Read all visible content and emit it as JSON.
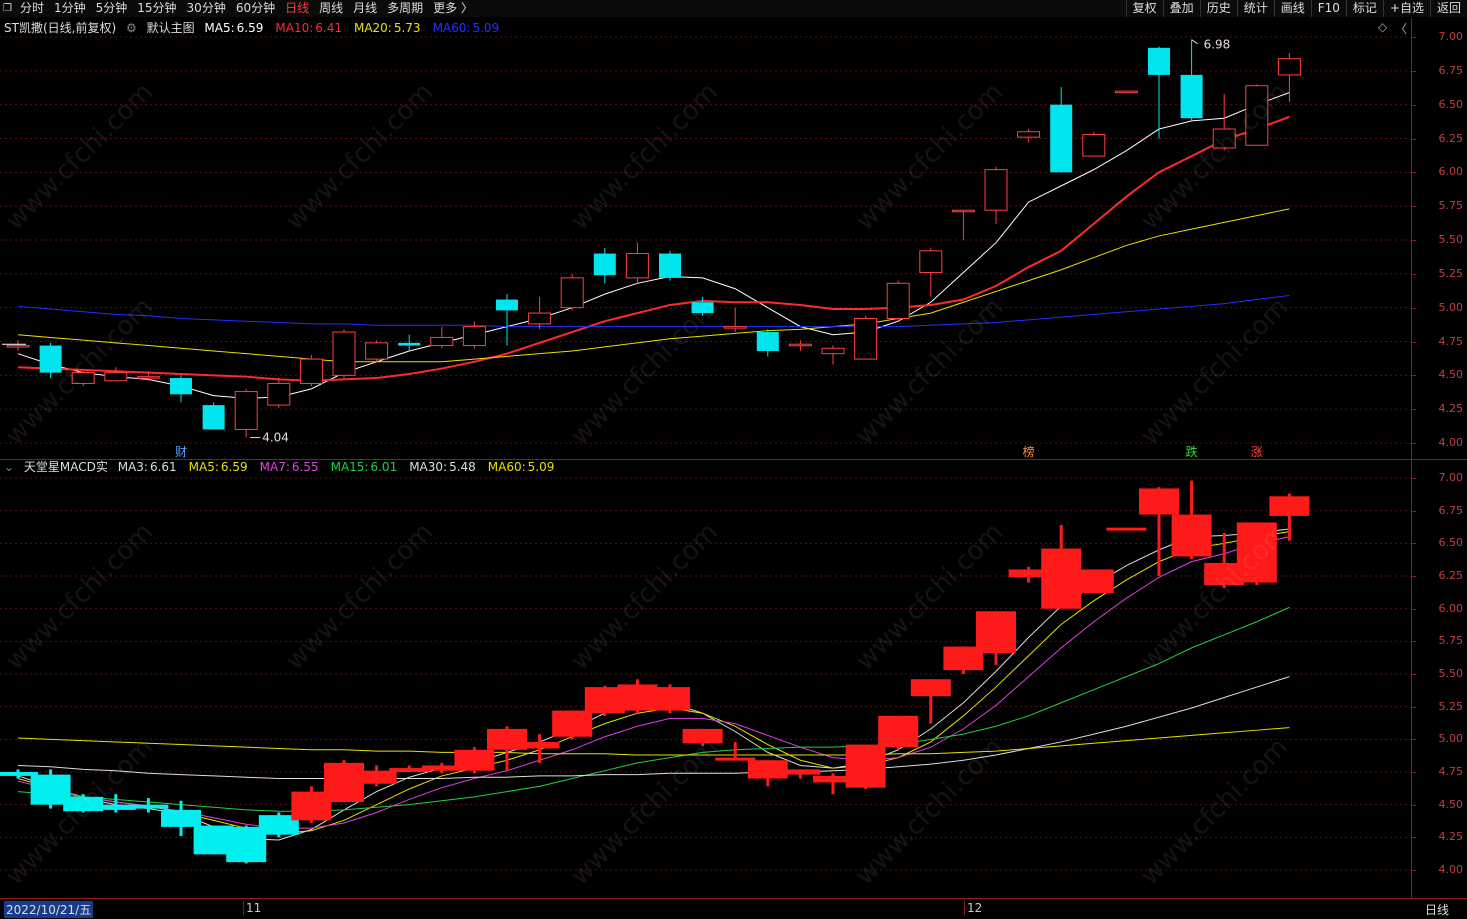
{
  "toolbar": {
    "corner_icon": "restore-icon",
    "periods": [
      "分时",
      "1分钟",
      "5分钟",
      "15分钟",
      "30分钟",
      "60分钟",
      "日线",
      "周线",
      "月线",
      "多周期",
      "更多 〉"
    ],
    "active_index": 6,
    "right_buttons": [
      "复权",
      "叠加",
      "历史",
      "统计",
      "画线",
      "F10",
      "标记",
      "+自选",
      "返回"
    ]
  },
  "main_panel": {
    "title": "ST凯撒(日线,前复权)",
    "indicator_name": "默认主图",
    "ma": [
      {
        "label": "MA5:",
        "value": "6.59",
        "color": "#ffffff"
      },
      {
        "label": "MA10:",
        "value": "6.41",
        "color": "#ff2a2a"
      },
      {
        "label": "MA20:",
        "value": "5.73",
        "color": "#e8e000"
      },
      {
        "label": "MA60:",
        "value": "5.09",
        "color": "#2030ff"
      }
    ],
    "y_ticks": [
      "7.00",
      "6.75",
      "6.50",
      "6.25",
      "6.00",
      "5.75",
      "5.50",
      "5.25",
      "5.00",
      "4.75",
      "4.50",
      "4.25",
      "4.00"
    ],
    "high_label": "6.98",
    "low_label": "4.04",
    "markers": [
      {
        "text": "财",
        "color": "#5aa0ff"
      },
      {
        "text": "榜",
        "color": "#ff8c3a"
      },
      {
        "text": "跌",
        "color": "#33dd33"
      },
      {
        "text": "涨",
        "color": "#ff4a4a"
      }
    ]
  },
  "sub_panel": {
    "title": "天堂星MACD实",
    "ma": [
      {
        "label": "MA3:",
        "value": "6.61",
        "color": "#dddddd"
      },
      {
        "label": "MA5:",
        "value": "6.59",
        "color": "#e8e000"
      },
      {
        "label": "MA7:",
        "value": "6.55",
        "color": "#e040e0"
      },
      {
        "label": "MA15:",
        "value": "6.01",
        "color": "#20d040"
      },
      {
        "label": "MA30:",
        "value": "5.48",
        "color": "#dddddd"
      },
      {
        "label": "MA60:",
        "value": "5.09",
        "color": "#e8e000"
      }
    ],
    "y_ticks": [
      "7.00",
      "6.75",
      "6.50",
      "6.25",
      "6.00",
      "5.75",
      "5.50",
      "5.25",
      "5.00",
      "4.75",
      "4.50",
      "4.25",
      "4.00"
    ]
  },
  "bottom_bar": {
    "date": "2022/10/21/五",
    "month_11": "11",
    "month_12": "12",
    "period": "日线"
  },
  "watermark": "www.cfchi.com",
  "chart_data": {
    "type": "candlestick",
    "ylim": [
      3.95,
      7.05
    ],
    "candles": [
      {
        "o": 4.72,
        "c": 4.72,
        "h": 4.76,
        "l": 4.68
      },
      {
        "o": 4.72,
        "c": 4.52,
        "h": 4.74,
        "l": 4.48
      },
      {
        "o": 4.44,
        "c": 4.52,
        "h": 4.54,
        "l": 4.42
      },
      {
        "o": 4.46,
        "c": 4.52,
        "h": 4.56,
        "l": 4.46
      },
      {
        "o": 4.49,
        "c": 4.49,
        "h": 4.53,
        "l": 4.46
      },
      {
        "o": 4.48,
        "c": 4.36,
        "h": 4.5,
        "l": 4.3
      },
      {
        "o": 4.28,
        "c": 4.1,
        "h": 4.3,
        "l": 4.1
      },
      {
        "o": 4.1,
        "c": 4.38,
        "h": 4.4,
        "l": 4.04
      },
      {
        "o": 4.28,
        "c": 4.44,
        "h": 4.48,
        "l": 4.26
      },
      {
        "o": 4.44,
        "c": 4.62,
        "h": 4.65,
        "l": 4.42
      },
      {
        "o": 4.5,
        "c": 4.82,
        "h": 4.84,
        "l": 4.48
      },
      {
        "o": 4.62,
        "c": 4.74,
        "h": 4.76,
        "l": 4.6
      },
      {
        "o": 4.74,
        "c": 4.72,
        "h": 4.8,
        "l": 4.68
      },
      {
        "o": 4.72,
        "c": 4.78,
        "h": 4.86,
        "l": 4.7
      },
      {
        "o": 4.72,
        "c": 4.86,
        "h": 4.9,
        "l": 4.7
      },
      {
        "o": 5.06,
        "c": 4.98,
        "h": 5.1,
        "l": 4.72
      },
      {
        "o": 4.88,
        "c": 4.96,
        "h": 5.08,
        "l": 4.84
      },
      {
        "o": 5.0,
        "c": 5.22,
        "h": 5.25,
        "l": 4.98
      },
      {
        "o": 5.4,
        "c": 5.24,
        "h": 5.44,
        "l": 5.18
      },
      {
        "o": 5.22,
        "c": 5.4,
        "h": 5.48,
        "l": 5.18
      },
      {
        "o": 5.4,
        "c": 5.22,
        "h": 5.42,
        "l": 5.2
      },
      {
        "o": 5.04,
        "c": 4.96,
        "h": 5.08,
        "l": 4.94
      },
      {
        "o": 4.86,
        "c": 4.86,
        "h": 5.0,
        "l": 4.82
      },
      {
        "o": 4.82,
        "c": 4.68,
        "h": 4.84,
        "l": 4.64
      },
      {
        "o": 4.73,
        "c": 4.73,
        "h": 4.76,
        "l": 4.68
      },
      {
        "o": 4.66,
        "c": 4.7,
        "h": 4.72,
        "l": 4.58
      },
      {
        "o": 4.62,
        "c": 4.92,
        "h": 4.94,
        "l": 4.62
      },
      {
        "o": 4.92,
        "c": 5.18,
        "h": 5.2,
        "l": 4.9
      },
      {
        "o": 5.26,
        "c": 5.42,
        "h": 5.44,
        "l": 5.08
      },
      {
        "o": 5.72,
        "c": 5.72,
        "h": 5.72,
        "l": 5.5
      },
      {
        "o": 5.72,
        "c": 6.02,
        "h": 6.04,
        "l": 5.62
      },
      {
        "o": 6.26,
        "c": 6.3,
        "h": 6.32,
        "l": 6.22
      },
      {
        "o": 6.5,
        "c": 6.0,
        "h": 6.63,
        "l": 6.0
      },
      {
        "o": 6.12,
        "c": 6.28,
        "h": 6.3,
        "l": 6.12
      },
      {
        "o": 6.6,
        "c": 6.6,
        "h": 6.6,
        "l": 6.6
      },
      {
        "o": 6.92,
        "c": 6.72,
        "h": 6.93,
        "l": 6.25
      },
      {
        "o": 6.72,
        "c": 6.4,
        "h": 6.98,
        "l": 6.38
      },
      {
        "o": 6.18,
        "c": 6.32,
        "h": 6.58,
        "l": 6.16
      },
      {
        "o": 6.2,
        "c": 6.64,
        "h": 6.65,
        "l": 6.2
      },
      {
        "o": 6.72,
        "c": 6.84,
        "h": 6.88,
        "l": 6.52
      }
    ],
    "sub_blocks": [
      {
        "o": 4.75,
        "c": 4.72,
        "h": 4.77,
        "l": 4.7
      },
      {
        "o": 4.73,
        "c": 4.5,
        "h": 4.77,
        "l": 4.47
      },
      {
        "o": 4.56,
        "c": 4.45,
        "h": 4.58,
        "l": 4.44
      },
      {
        "o": 4.5,
        "c": 4.46,
        "h": 4.58,
        "l": 4.44
      },
      {
        "o": 4.5,
        "c": 4.47,
        "h": 4.55,
        "l": 4.44
      },
      {
        "o": 4.46,
        "c": 4.33,
        "h": 4.53,
        "l": 4.26
      },
      {
        "o": 4.34,
        "c": 4.12,
        "h": 4.34,
        "l": 4.12
      },
      {
        "o": 4.33,
        "c": 4.06,
        "h": 4.34,
        "l": 4.05
      },
      {
        "o": 4.42,
        "c": 4.27,
        "h": 4.44,
        "l": 4.25
      },
      {
        "o": 4.38,
        "c": 4.6,
        "h": 4.64,
        "l": 4.36
      },
      {
        "o": 4.52,
        "c": 4.82,
        "h": 4.84,
        "l": 4.52
      },
      {
        "o": 4.66,
        "c": 4.76,
        "h": 4.8,
        "l": 4.64
      },
      {
        "o": 4.75,
        "c": 4.78,
        "h": 4.8,
        "l": 4.75
      },
      {
        "o": 4.76,
        "c": 4.8,
        "h": 4.82,
        "l": 4.74
      },
      {
        "o": 4.76,
        "c": 4.92,
        "h": 4.94,
        "l": 4.74
      },
      {
        "o": 4.92,
        "c": 5.08,
        "h": 5.1,
        "l": 4.76
      },
      {
        "o": 4.93,
        "c": 4.98,
        "h": 5.04,
        "l": 4.82
      },
      {
        "o": 5.02,
        "c": 5.22,
        "h": 5.22,
        "l": 5.0
      },
      {
        "o": 5.2,
        "c": 5.4,
        "h": 5.41,
        "l": 5.18
      },
      {
        "o": 5.22,
        "c": 5.42,
        "h": 5.46,
        "l": 5.2
      },
      {
        "o": 5.22,
        "c": 5.4,
        "h": 5.42,
        "l": 5.2
      },
      {
        "o": 4.97,
        "c": 5.08,
        "h": 5.08,
        "l": 4.95
      },
      {
        "o": 4.86,
        "c": 4.86,
        "h": 4.98,
        "l": 4.84
      },
      {
        "o": 4.7,
        "c": 4.84,
        "h": 4.84,
        "l": 4.64
      },
      {
        "o": 4.73,
        "c": 4.77,
        "h": 4.77,
        "l": 4.7
      },
      {
        "o": 4.67,
        "c": 4.72,
        "h": 4.74,
        "l": 4.58
      },
      {
        "o": 4.63,
        "c": 4.96,
        "h": 4.96,
        "l": 4.62
      },
      {
        "o": 4.94,
        "c": 5.18,
        "h": 5.18,
        "l": 4.92
      },
      {
        "o": 5.33,
        "c": 5.46,
        "h": 5.46,
        "l": 5.12
      },
      {
        "o": 5.53,
        "c": 5.71,
        "h": 5.71,
        "l": 5.5
      },
      {
        "o": 5.66,
        "c": 5.98,
        "h": 5.98,
        "l": 5.57
      },
      {
        "o": 6.24,
        "c": 6.3,
        "h": 6.32,
        "l": 6.2
      },
      {
        "o": 6.0,
        "c": 6.46,
        "h": 6.64,
        "l": 6.0
      },
      {
        "o": 6.12,
        "c": 6.3,
        "h": 6.3,
        "l": 6.12
      },
      {
        "o": 6.61,
        "c": 6.62,
        "h": 6.62,
        "l": 6.61
      },
      {
        "o": 6.72,
        "c": 6.92,
        "h": 6.93,
        "l": 6.25
      },
      {
        "o": 6.4,
        "c": 6.72,
        "h": 6.98,
        "l": 6.38
      },
      {
        "o": 6.18,
        "c": 6.35,
        "h": 6.58,
        "l": 6.16
      },
      {
        "o": 6.2,
        "c": 6.66,
        "h": 6.66,
        "l": 6.18
      },
      {
        "o": 6.71,
        "c": 6.86,
        "h": 6.88,
        "l": 6.52
      }
    ],
    "main_ma": {
      "MA5": [
        4.66,
        4.58,
        4.52,
        4.49,
        4.47,
        4.42,
        4.35,
        4.33,
        4.34,
        4.4,
        4.52,
        4.6,
        4.68,
        4.74,
        4.8,
        4.86,
        4.92,
        5.0,
        5.1,
        5.18,
        5.23,
        5.22,
        5.14,
        5.0,
        4.86,
        4.8,
        4.82,
        4.9,
        5.04,
        5.26,
        5.48,
        5.78,
        5.9,
        6.02,
        6.16,
        6.32,
        6.38,
        6.4,
        6.5,
        6.59
      ],
      "MA10": [
        4.56,
        4.55,
        4.54,
        4.53,
        4.52,
        4.51,
        4.5,
        4.49,
        4.47,
        4.46,
        4.47,
        4.48,
        4.51,
        4.55,
        4.6,
        4.66,
        4.74,
        4.82,
        4.9,
        4.96,
        5.02,
        5.05,
        5.04,
        5.04,
        5.02,
        4.99,
        4.99,
        5.0,
        5.02,
        5.06,
        5.16,
        5.3,
        5.42,
        5.62,
        5.82,
        6.0,
        6.12,
        6.24,
        6.32,
        6.41
      ],
      "MA20": [
        4.8,
        4.78,
        4.76,
        4.74,
        4.72,
        4.7,
        4.68,
        4.66,
        4.64,
        4.62,
        4.6,
        4.6,
        4.6,
        4.6,
        4.62,
        4.64,
        4.66,
        4.68,
        4.71,
        4.74,
        4.77,
        4.79,
        4.81,
        4.83,
        4.84,
        4.86,
        4.88,
        4.92,
        4.96,
        5.04,
        5.12,
        5.2,
        5.28,
        5.37,
        5.46,
        5.53,
        5.58,
        5.63,
        5.68,
        5.73
      ],
      "MA60": [
        5.01,
        4.99,
        4.97,
        4.95,
        4.94,
        4.92,
        4.91,
        4.9,
        4.89,
        4.88,
        4.88,
        4.87,
        4.87,
        4.87,
        4.87,
        4.86,
        4.86,
        4.86,
        4.86,
        4.86,
        4.86,
        4.86,
        4.86,
        4.86,
        4.86,
        4.86,
        4.86,
        4.86,
        4.87,
        4.88,
        4.89,
        4.91,
        4.93,
        4.95,
        4.97,
        4.99,
        5.01,
        5.03,
        5.06,
        5.09
      ]
    },
    "sub_ma": {
      "MA3": [
        4.72,
        4.64,
        4.55,
        4.5,
        4.47,
        4.43,
        4.33,
        4.24,
        4.23,
        4.31,
        4.46,
        4.6,
        4.71,
        4.78,
        4.82,
        4.9,
        4.98,
        5.08,
        5.2,
        5.28,
        5.28,
        5.2,
        5.06,
        4.9,
        4.8,
        4.78,
        4.82,
        4.92,
        5.08,
        5.28,
        5.52,
        5.78,
        6.02,
        6.18,
        6.33,
        6.45,
        6.55,
        6.56,
        6.58,
        6.61
      ],
      "MA5": [
        4.7,
        4.63,
        4.56,
        4.52,
        4.49,
        4.44,
        4.38,
        4.32,
        4.28,
        4.3,
        4.38,
        4.5,
        4.62,
        4.72,
        4.78,
        4.84,
        4.92,
        5.02,
        5.12,
        5.2,
        5.24,
        5.2,
        5.1,
        4.96,
        4.84,
        4.78,
        4.8,
        4.86,
        4.98,
        5.18,
        5.4,
        5.64,
        5.88,
        6.06,
        6.22,
        6.36,
        6.46,
        6.5,
        6.55,
        6.59
      ],
      "MA7": [
        4.68,
        4.62,
        4.56,
        4.52,
        4.49,
        4.45,
        4.4,
        4.35,
        4.32,
        4.32,
        4.36,
        4.44,
        4.54,
        4.63,
        4.7,
        4.76,
        4.84,
        4.92,
        5.02,
        5.1,
        5.16,
        5.16,
        5.12,
        5.03,
        4.94,
        4.86,
        4.84,
        4.86,
        4.94,
        5.08,
        5.26,
        5.48,
        5.7,
        5.9,
        6.08,
        6.24,
        6.36,
        6.42,
        6.5,
        6.55
      ],
      "MA15": [
        4.6,
        4.58,
        4.56,
        4.54,
        4.52,
        4.5,
        4.48,
        4.46,
        4.45,
        4.45,
        4.46,
        4.48,
        4.5,
        4.53,
        4.56,
        4.6,
        4.64,
        4.7,
        4.76,
        4.82,
        4.86,
        4.9,
        4.92,
        4.93,
        4.94,
        4.94,
        4.95,
        4.96,
        5.0,
        5.04,
        5.1,
        5.18,
        5.28,
        5.38,
        5.48,
        5.58,
        5.7,
        5.8,
        5.9,
        6.01
      ],
      "MA30": [
        4.8,
        4.79,
        4.77,
        4.76,
        4.74,
        4.73,
        4.72,
        4.71,
        4.7,
        4.7,
        4.7,
        4.7,
        4.7,
        4.7,
        4.71,
        4.71,
        4.72,
        4.72,
        4.73,
        4.73,
        4.74,
        4.74,
        4.74,
        4.75,
        4.75,
        4.76,
        4.77,
        4.79,
        4.81,
        4.84,
        4.88,
        4.93,
        4.98,
        5.04,
        5.1,
        5.17,
        5.24,
        5.32,
        5.4,
        5.48
      ],
      "MA60": [
        5.01,
        5.0,
        4.99,
        4.98,
        4.97,
        4.96,
        4.95,
        4.94,
        4.93,
        4.92,
        4.92,
        4.91,
        4.91,
        4.9,
        4.9,
        4.9,
        4.89,
        4.89,
        4.89,
        4.88,
        4.88,
        4.88,
        4.88,
        4.88,
        4.88,
        4.88,
        4.88,
        4.89,
        4.89,
        4.9,
        4.91,
        4.93,
        4.95,
        4.97,
        4.99,
        5.01,
        5.03,
        5.05,
        5.07,
        5.09
      ]
    }
  }
}
